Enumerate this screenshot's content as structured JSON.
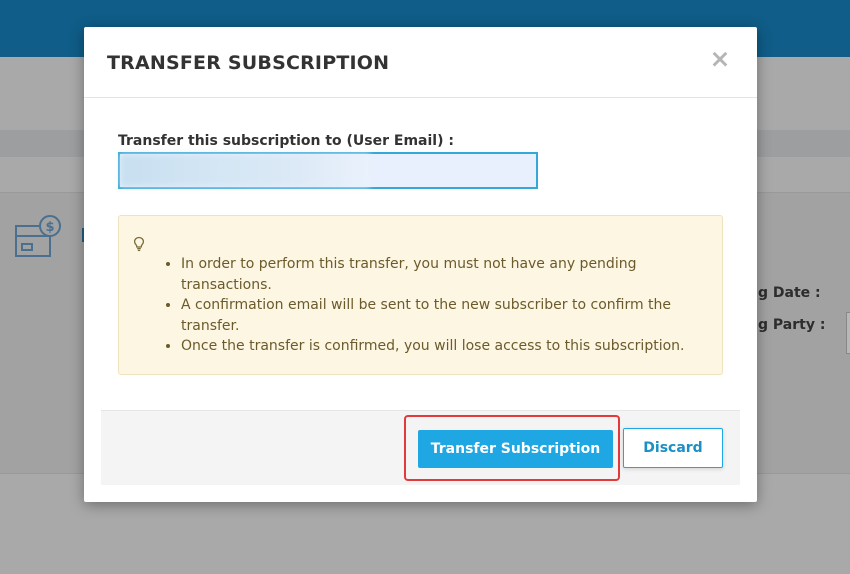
{
  "background": {
    "labels": {
      "date_label": "g Date :",
      "party_label": "g Party :"
    }
  },
  "modal": {
    "title": "TRANSFER SUBSCRIPTION",
    "close_label": "×",
    "field_label": "Transfer this subscription to (User Email) :",
    "email_value": "",
    "notes": [
      "In order to perform this transfer, you must not have any pending transactions.",
      "A confirmation email will be sent to the new subscriber to confirm the transfer.",
      "Once the transfer is confirmed, you will lose access to this subscription."
    ],
    "icons": {
      "note": "lightbulb-icon",
      "close": "close-icon",
      "background": "subscription-icon"
    },
    "buttons": {
      "primary": "Transfer Subscription",
      "secondary": "Discard"
    },
    "colors": {
      "primary": "#1fa7e3",
      "highlight": "#e23a3a",
      "note_bg": "#fdf6e2",
      "topbar": "#0f5d88"
    }
  }
}
